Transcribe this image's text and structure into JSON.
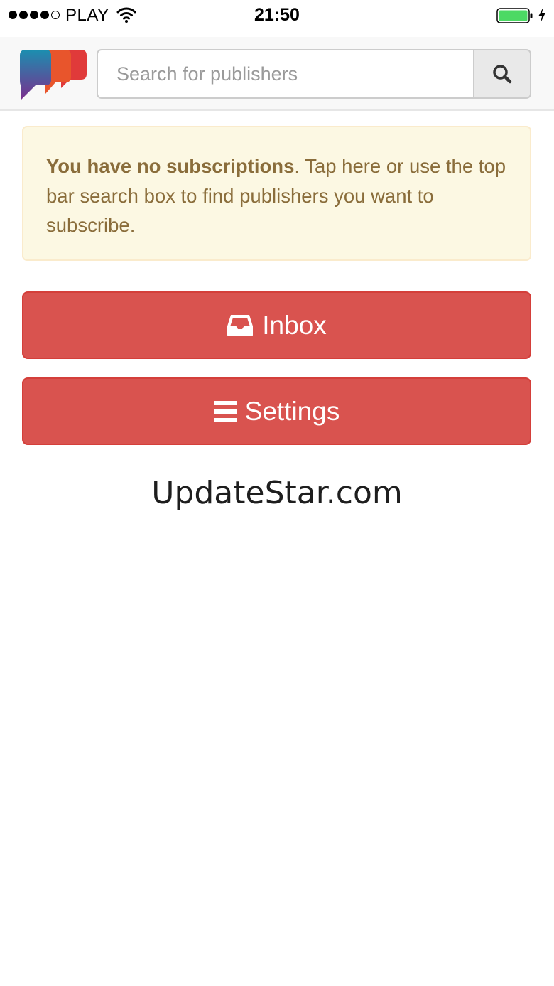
{
  "status_bar": {
    "carrier": "PLAY",
    "time": "21:50",
    "signal_bars_filled": 4,
    "signal_bars_total": 5,
    "battery_color": "#4cd964"
  },
  "header": {
    "logo_colors": [
      "#e8452c",
      "#c0392b",
      "#1b8fb0",
      "#7b2e8e"
    ],
    "search": {
      "placeholder": "Search for publishers",
      "value": "",
      "button_icon": "search-icon"
    }
  },
  "alert": {
    "bold_text": "You have no subscriptions",
    "text": ". Tap here or use the top bar search box to find publishers you want to subscribe."
  },
  "buttons": {
    "inbox": {
      "label": "Inbox",
      "icon": "inbox-icon"
    },
    "settings": {
      "label": "Settings",
      "icon": "menu-icon"
    }
  },
  "watermark": "UpdateStar.com",
  "colors": {
    "button_red": "#d9534f",
    "alert_background": "#fcf8e3",
    "alert_text": "#8a6d3b"
  }
}
